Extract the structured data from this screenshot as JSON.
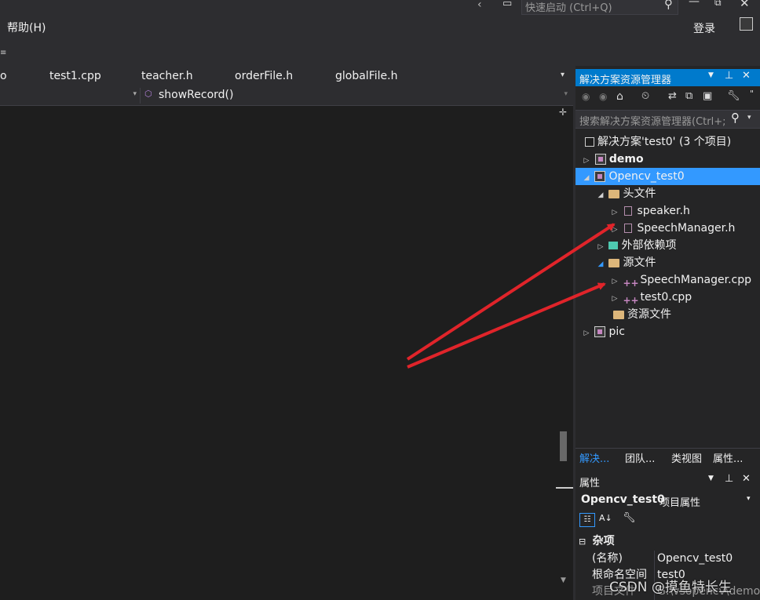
{
  "titlebar": {
    "quick_launch_placeholder": "快速启动 (Ctrl+Q)"
  },
  "menubar": {
    "help_menu": "帮助(H)",
    "login": "登录"
  },
  "tabs": [
    {
      "label": "o"
    },
    {
      "label": "test1.cpp"
    },
    {
      "label": "teacher.h"
    },
    {
      "label": "orderFile.h"
    },
    {
      "label": "globalFile.h"
    }
  ],
  "navbar": {
    "member_label": "showRecord()"
  },
  "solution_explorer": {
    "title": "解决方案资源管理器",
    "search_placeholder": "搜索解决方案资源管理器(Ctrl+;",
    "solution_label": "解决方案'test0' (3 个项目)",
    "tree": [
      {
        "label": "demo"
      },
      {
        "label": "Opencv_test0"
      },
      {
        "label": "头文件"
      },
      {
        "label": "speaker.h"
      },
      {
        "label": "SpeechManager.h"
      },
      {
        "label": "外部依赖项"
      },
      {
        "label": "源文件"
      },
      {
        "label": "SpeechManager.cpp"
      },
      {
        "label": "test0.cpp"
      },
      {
        "label": "资源文件"
      },
      {
        "label": "pic"
      }
    ],
    "bottom_tabs": [
      "解决...",
      "团队...",
      "类视图",
      "属性..."
    ]
  },
  "properties": {
    "title": "属性",
    "object_name": "Opencv_test0",
    "object_type": "项目属性",
    "category": "杂项",
    "rows": [
      {
        "name": "(名称)",
        "value": "Opencv_test0"
      },
      {
        "name": "根命名空间",
        "value": "test0"
      },
      {
        "name": "项目文件",
        "value": "G:\\vsopencv\\demo"
      }
    ]
  },
  "watermark": "CSDN @摸鱼特长生",
  "colors": {
    "selection": "#3399ff",
    "arrow": "#e0242a",
    "background": "#1e1e1e"
  }
}
